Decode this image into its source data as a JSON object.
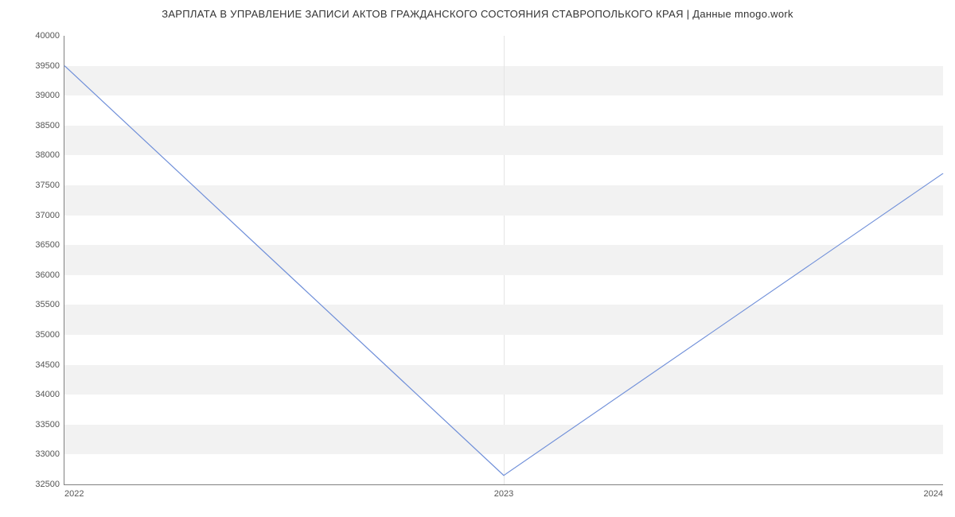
{
  "chart_data": {
    "type": "line",
    "title": "ЗАРПЛАТА В УПРАВЛЕНИЕ ЗАПИСИ АКТОВ ГРАЖДАНСКОГО СОСТОЯНИЯ СТАВРОПОЛЬКОГО КРАЯ | Данные mnogo.work",
    "x": [
      2022,
      2023,
      2024
    ],
    "values": [
      39500,
      32650,
      37700
    ],
    "xticks": [
      "2022",
      "2023",
      "2024"
    ],
    "yticks": [
      32500,
      33000,
      33500,
      34000,
      34500,
      35000,
      35500,
      36000,
      36500,
      37000,
      37500,
      38000,
      38500,
      39000,
      39500,
      40000
    ],
    "ylim": [
      32500,
      40000
    ],
    "xlim": [
      2022,
      2024
    ],
    "xlabel": "",
    "ylabel": "",
    "grid": "banded"
  }
}
